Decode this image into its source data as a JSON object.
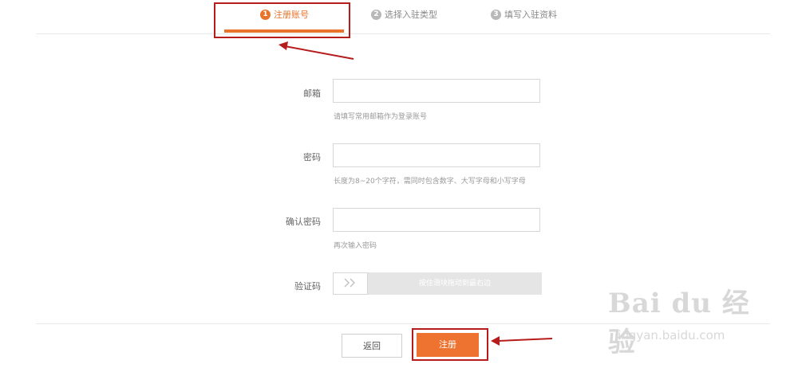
{
  "steps": [
    {
      "num": "1",
      "label": "注册账号",
      "active": true
    },
    {
      "num": "2",
      "label": "选择入驻类型",
      "active": false
    },
    {
      "num": "3",
      "label": "填写入驻资料",
      "active": false
    }
  ],
  "form": {
    "email": {
      "label": "邮箱",
      "value": "",
      "hint": "请填写常用邮箱作为登录账号"
    },
    "password": {
      "label": "密码",
      "value": "",
      "hint": "长度为8~20个字符，需同时包含数字、大写字母和小写字母"
    },
    "confirm_password": {
      "label": "确认密码",
      "value": "",
      "hint": "再次输入密码"
    },
    "captcha": {
      "label": "验证码",
      "slider_text": "按住滑块拖动到最右边"
    }
  },
  "buttons": {
    "back": "返回",
    "submit": "注册"
  },
  "watermark": {
    "big": "Bai du 经验",
    "small": "jingyan.baidu.com"
  },
  "colors": {
    "accent": "#ee7330",
    "annotation": "#b71c1c"
  }
}
